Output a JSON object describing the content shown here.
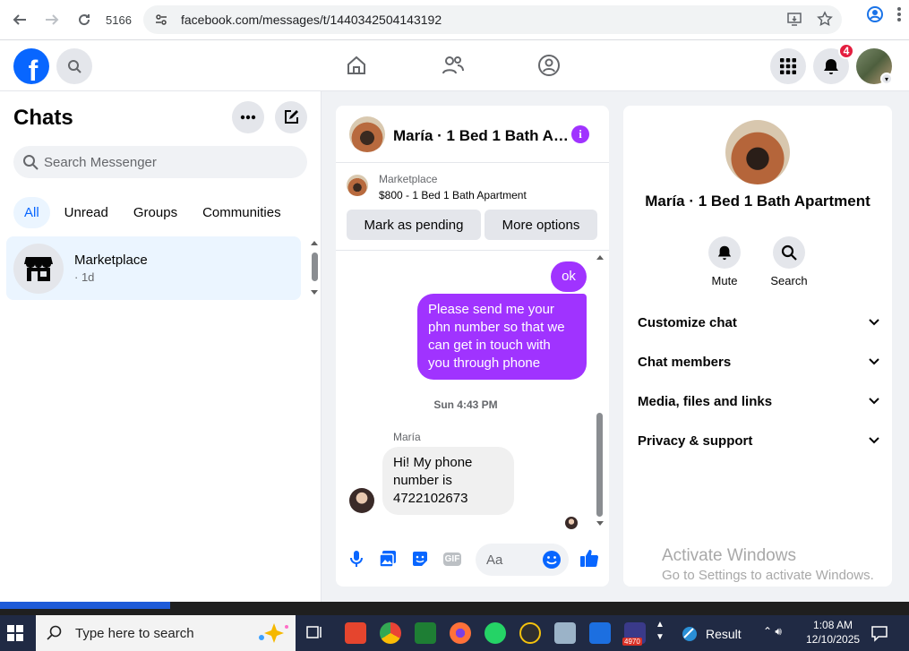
{
  "browser": {
    "tab_count": "5166",
    "url": "facebook.com/messages/t/1440342504143192"
  },
  "top_nav": {
    "notification_count": "4"
  },
  "sidebar": {
    "title": "Chats",
    "search_placeholder": "Search Messenger",
    "filters": [
      "All",
      "Unread",
      "Groups",
      "Communities"
    ],
    "active_filter": "All",
    "chats": [
      {
        "name": "Marketplace",
        "subtitle": "· 1d"
      }
    ]
  },
  "conversation": {
    "header_name": "María · 1 Bed 1 Bath A…",
    "marketplace_label": "Marketplace",
    "listing_title": "$800 - 1 Bed 1 Bath Apartment",
    "mark_pending_label": "Mark as pending",
    "more_options_label": "More options",
    "messages_out": [
      "ok",
      "Please send me your phn number so that we can get in touch with you through phone"
    ],
    "timestamp": "Sun 4:43 PM",
    "sender_name": "María",
    "message_in": "Hi! My phone number is 4722102673",
    "composer_placeholder": "Aa"
  },
  "info_panel": {
    "name": "María · 1 Bed 1 Bath Apartment",
    "actions": [
      "Mute",
      "Search"
    ],
    "sections": [
      "Customize chat",
      "Chat members",
      "Media, files and links",
      "Privacy & support"
    ]
  },
  "watermark": {
    "line1": "Activate Windows",
    "line2": "Go to Settings to activate Windows."
  },
  "taskbar": {
    "search_placeholder": "Type here to search",
    "result_label": "Result",
    "time": "1:08 AM",
    "date": "12/10/2025",
    "app_badge": "4970"
  },
  "colors": {
    "fb_blue": "#0866ff",
    "message_purple": "#a033ff",
    "badge_red": "#e41e3f"
  }
}
